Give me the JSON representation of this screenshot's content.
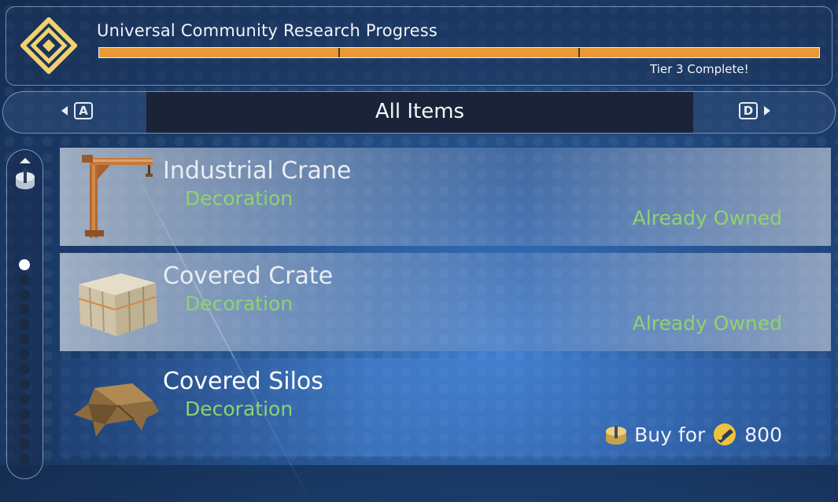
{
  "research": {
    "title": "Universal Community Research Progress",
    "status": "Tier 3 Complete!",
    "tiers_total": 3,
    "tiers_complete": 3,
    "progress_color": "#e99a37"
  },
  "category": {
    "title": "All Items",
    "prev_key": "A",
    "next_key": "D"
  },
  "items": [
    {
      "name": "Industrial Crane",
      "category": "Decoration",
      "status": "Already Owned",
      "icon": "industrial-crane-icon"
    },
    {
      "name": "Covered Crate",
      "category": "Decoration",
      "status": "Already Owned",
      "icon": "covered-crate-icon"
    },
    {
      "name": "Covered Silos",
      "category": "Decoration",
      "buy_label": "Buy for",
      "price": "800",
      "icon": "covered-silos-icon"
    }
  ],
  "colors": {
    "accent_green": "#8fd26e",
    "emblem_gold": "#f2d270"
  }
}
